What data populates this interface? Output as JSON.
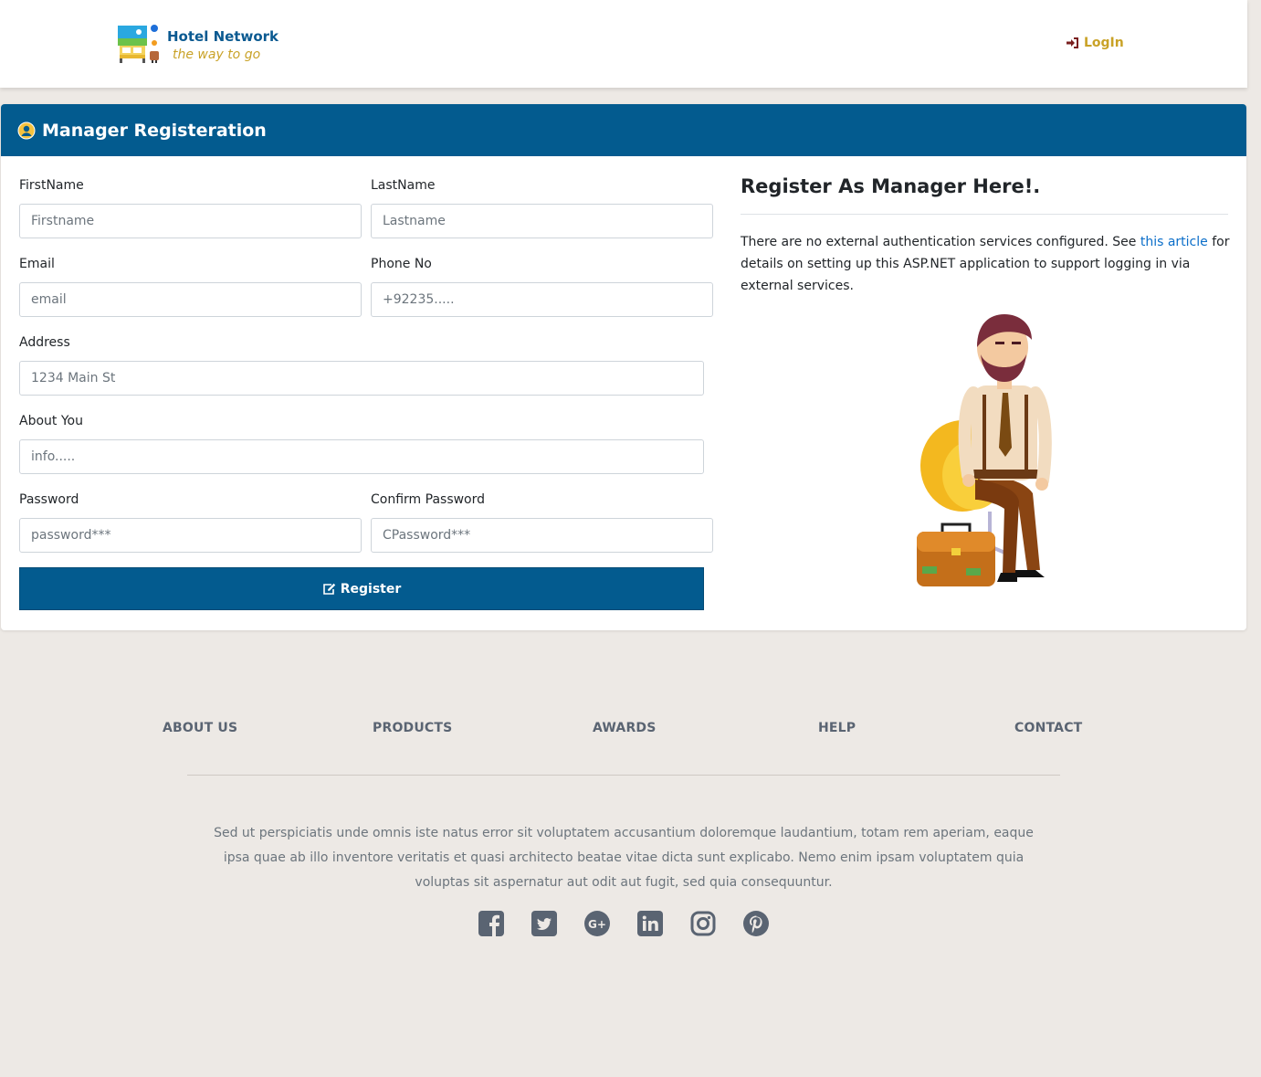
{
  "header": {
    "brand_title": "Hotel Network",
    "brand_tagline": "the way to go",
    "login_label": "LogIn"
  },
  "card": {
    "title": "Manager Registeration",
    "form": {
      "firstname": {
        "label": "FirstName",
        "placeholder": "Firstname"
      },
      "lastname": {
        "label": "LastName",
        "placeholder": "Lastname"
      },
      "email": {
        "label": "Email",
        "placeholder": "email"
      },
      "phone": {
        "label": "Phone No",
        "placeholder": "+92235....."
      },
      "address": {
        "label": "Address",
        "placeholder": "1234 Main St"
      },
      "about": {
        "label": "About You",
        "placeholder": "info....."
      },
      "password": {
        "label": "Password",
        "placeholder": "password***"
      },
      "confirm_password": {
        "label": "Confirm Password",
        "placeholder": "CPassword***"
      },
      "submit_label": "Register"
    },
    "side": {
      "title": "Register As Manager Here!.",
      "text_before": "There are no external authentication services configured. See ",
      "link_text": "this article",
      "text_after": " for details on setting up this ASP.NET application to support logging in via external services."
    }
  },
  "footer": {
    "nav": [
      "ABOUT US",
      "PRODUCTS",
      "AWARDS",
      "HELP",
      "CONTACT"
    ],
    "text": "Sed ut perspiciatis unde omnis iste natus error sit voluptatem accusantium doloremque laudantium, totam rem aperiam, eaque ipsa quae ab illo inventore veritatis et quasi architecto beatae vitae dicta sunt explicabo. Nemo enim ipsam voluptatem quia voluptas sit aspernatur aut odit aut fugit, sed quia consequuntur.",
    "socials": [
      "facebook-icon",
      "twitter-icon",
      "google-plus-icon",
      "linkedin-icon",
      "instagram-icon",
      "pinterest-icon"
    ]
  },
  "colors": {
    "primary": "#035b8f",
    "accent": "#c9a227",
    "link": "#0b6ec9",
    "footer_bg": "#ede9e5",
    "footer_text": "#5a6472"
  }
}
